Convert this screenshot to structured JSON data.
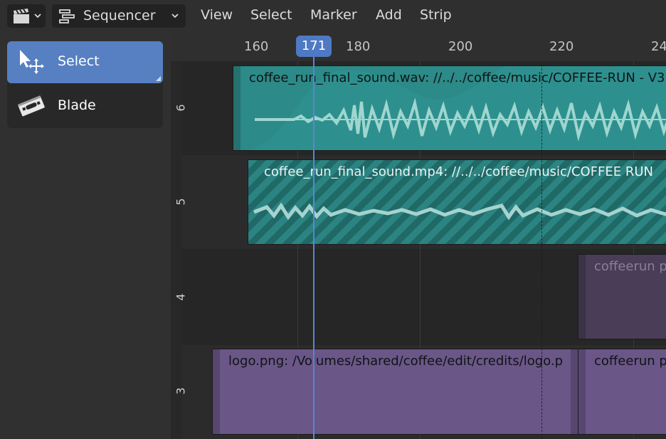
{
  "header": {
    "editor_type_icon": "clapperboard-icon",
    "mode": {
      "icon": "sequencer-icon",
      "label": "Sequencer"
    },
    "menus": [
      "View",
      "Select",
      "Marker",
      "Add",
      "Strip"
    ]
  },
  "toolbar": {
    "tools": [
      {
        "label": "Select",
        "icon": "select-tweak-icon",
        "active": true
      },
      {
        "label": "Blade",
        "icon": "razor-blade-icon",
        "active": false
      }
    ]
  },
  "timeline": {
    "ruler_ticks": [
      "160",
      "180",
      "200",
      "220",
      "24"
    ],
    "current_frame": "171",
    "channels": [
      "6",
      "5",
      "4",
      "3"
    ],
    "strips": [
      {
        "type": "sound",
        "label": "coffee_run_final_sound.wav: //../../coffee/music/COFFEE-RUN - V3"
      },
      {
        "type": "movie",
        "label": "coffee_run_final_sound.mp4: //../../coffee/music/COFFEE RUN"
      },
      {
        "type": "image",
        "label": "coffeerun p"
      },
      {
        "type": "image",
        "label": "logo.png: /Volumes/shared/coffee/edit/credits/logo.p"
      },
      {
        "type": "image",
        "label": "coffeerun p"
      }
    ]
  },
  "colors": {
    "accent": "#5680c2",
    "sound_strip": "#2c8a88",
    "movie_strip": "#2b8482",
    "image_strip": "#6b5688",
    "playhead": "#5b86d1"
  }
}
